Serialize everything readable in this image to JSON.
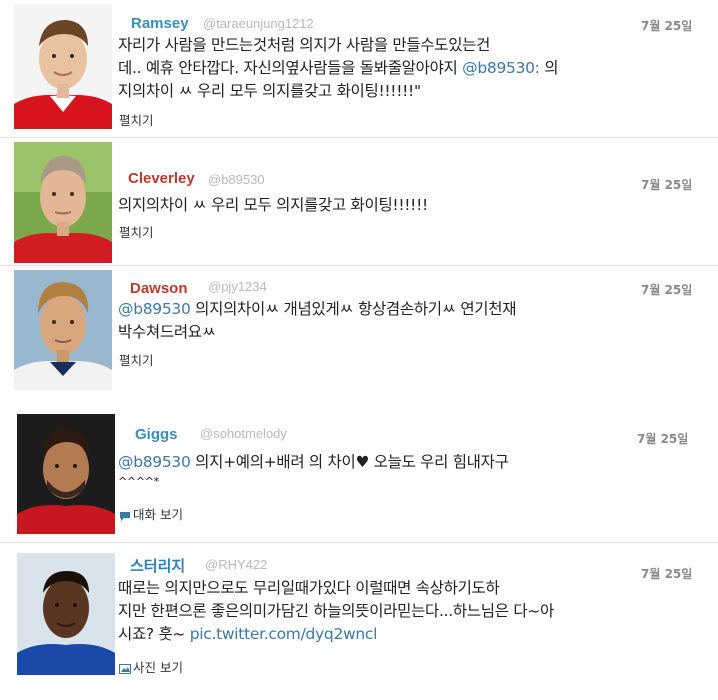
{
  "tweets": [
    {
      "name": "Ramsey",
      "handle": "@taraeunjung1212",
      "date": "7월 25일",
      "lines": [
        {
          "pre": "자리가 사람을 만드는것처럼 의지가 사람을 만들수도있는건",
          "mention": "",
          "post": ""
        },
        {
          "pre": "데.. 예휴 안타깝다. 자신의옆사람들을 돌봐줄알아야지 ",
          "mention": "@b89530:",
          "post": " 의"
        },
        {
          "pre": "지의차이 ㅆ 우리 모두 의지를갖고 화이팅!!!!!!\"",
          "mention": "",
          "post": ""
        }
      ],
      "action": "펼치기"
    },
    {
      "name": "Cleverley",
      "handle": "@b89530",
      "date": "7월 25일",
      "lines": [
        {
          "pre": "의지의차이 ㅆ 우리 모두 의지를갖고 화이팅!!!!!!",
          "mention": "",
          "post": ""
        }
      ],
      "action": "펼치기"
    },
    {
      "name": "Dawson",
      "handle": "@pjy1234",
      "date": "7월 25일",
      "lines": [
        {
          "pre": "",
          "mention": "@b89530",
          "post": " 의지의차이ㅆ 개념있게ㅆ 항상겸손하기ㅆ 연기천재"
        },
        {
          "pre": "박수쳐드려요ㅆ",
          "mention": "",
          "post": ""
        }
      ],
      "action": "펼치기"
    },
    {
      "name": "Giggs",
      "handle": "@sohotmelody",
      "date": "7월 25일",
      "lines": [
        {
          "pre": "",
          "mention": "@b89530",
          "post": " 의지+예의+배려 의 차이♥ 오늘도 우리 힘내자구"
        },
        {
          "pre": "^^^^*",
          "mention": "",
          "post": ""
        }
      ],
      "action": "대화 보기"
    },
    {
      "name": "스터리지",
      "handle": "@RHY422",
      "date": "7월 25일",
      "lines": [
        {
          "pre": "때로는 의지만으로도 무리일때가있다 이럴때면 속상하기도하",
          "mention": "",
          "post": ""
        },
        {
          "pre": "지만 한편으론 좋은의미가담긴 하늘의뜻이라믿는다...하느님은 다~아",
          "mention": "",
          "post": ""
        },
        {
          "pre": "시죠? 훗~ ",
          "link": "pic.twitter.com/dyq2wncl",
          "mention": "",
          "post": ""
        }
      ],
      "action": "사진 보기"
    }
  ],
  "colors": {
    "name_ramsey": "#3a8fc0",
    "name_cleverley": "#c0392b",
    "name_dawson": "#c0392b",
    "name_giggs": "#3a8fc0",
    "name_sturridge": "#2a7fc0",
    "mention": "#3b78a8"
  },
  "icons": {
    "expand": "none",
    "conversation": "speech-bubble-icon",
    "photo": "photo-icon"
  }
}
